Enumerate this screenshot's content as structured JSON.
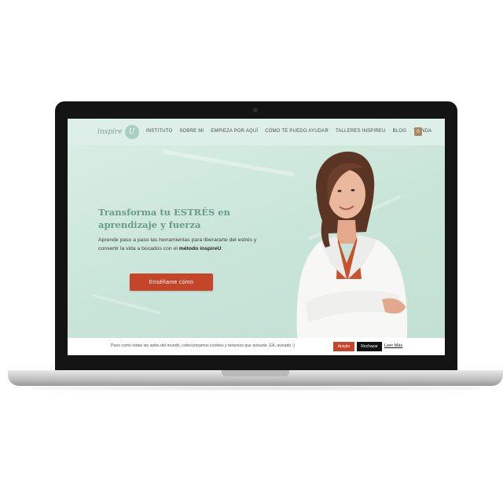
{
  "site": {
    "logo_text": "inspire",
    "logo_mark": "U"
  },
  "nav": {
    "items": [
      {
        "label": "INSTITUTO"
      },
      {
        "label": "SOBRE MI"
      },
      {
        "label": "EMPIEZA POR AQUÍ"
      },
      {
        "label": "CÓMO TE PUEDO AYUDAR"
      },
      {
        "label": "TALLERES INSPIREU"
      },
      {
        "label": "BLOG"
      },
      {
        "label": "TIENDA"
      }
    ],
    "cart_count": "0"
  },
  "hero": {
    "title_line1": "Transforma tu ESTRÉS en",
    "title_line2": "aprendizaje y fuerza",
    "subtitle_part1": "Aprende paso a paso las herramientas para liberararte del estrés y convertir la vida a bocados con el ",
    "subtitle_bold": "método inspireU",
    "subtitle_end": ".",
    "cta_label": "Enséñame cómo"
  },
  "cookie": {
    "text": "Pues como todas las webs del mundo, coleccionamos cookies y tenemos que avisarte. EA, avisado :)",
    "accept_label": "Acepto",
    "reject_label": "Rechazar",
    "read_more_label": "Leer Más"
  },
  "colors": {
    "accent": "#c4452a",
    "brand_green": "#6a9b8a",
    "hero_bg": "#c9e5d9"
  }
}
